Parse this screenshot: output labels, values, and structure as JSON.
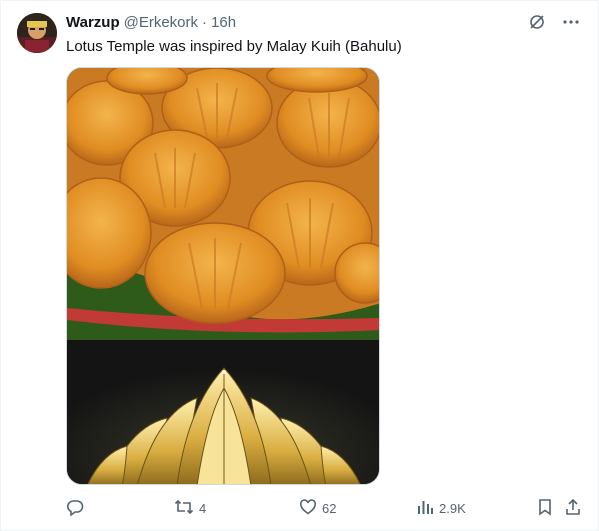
{
  "tweet": {
    "author_name": "Warzup",
    "author_handle": "@Erkekork",
    "separator": "·",
    "time": "16h",
    "text": "Lotus Temple was inspired by Malay Kuih (Bahulu)"
  },
  "media": {
    "top_image": "kuih-bahulu-photo",
    "bottom_image": "lotus-temple-night-photo"
  },
  "actions": {
    "replies": "",
    "reposts": "4",
    "likes": "62",
    "views": "2.9K"
  },
  "icons": {
    "reply": "reply-icon",
    "repost": "repost-icon",
    "like": "heart-icon",
    "views": "views-icon",
    "bookmark": "bookmark-icon",
    "share": "share-icon",
    "grok": "grok-icon",
    "more": "more-icon"
  },
  "colors": {
    "text": "#0f1419",
    "muted": "#536471",
    "border": "#cfd9de",
    "accent": "#1d9bf0"
  }
}
